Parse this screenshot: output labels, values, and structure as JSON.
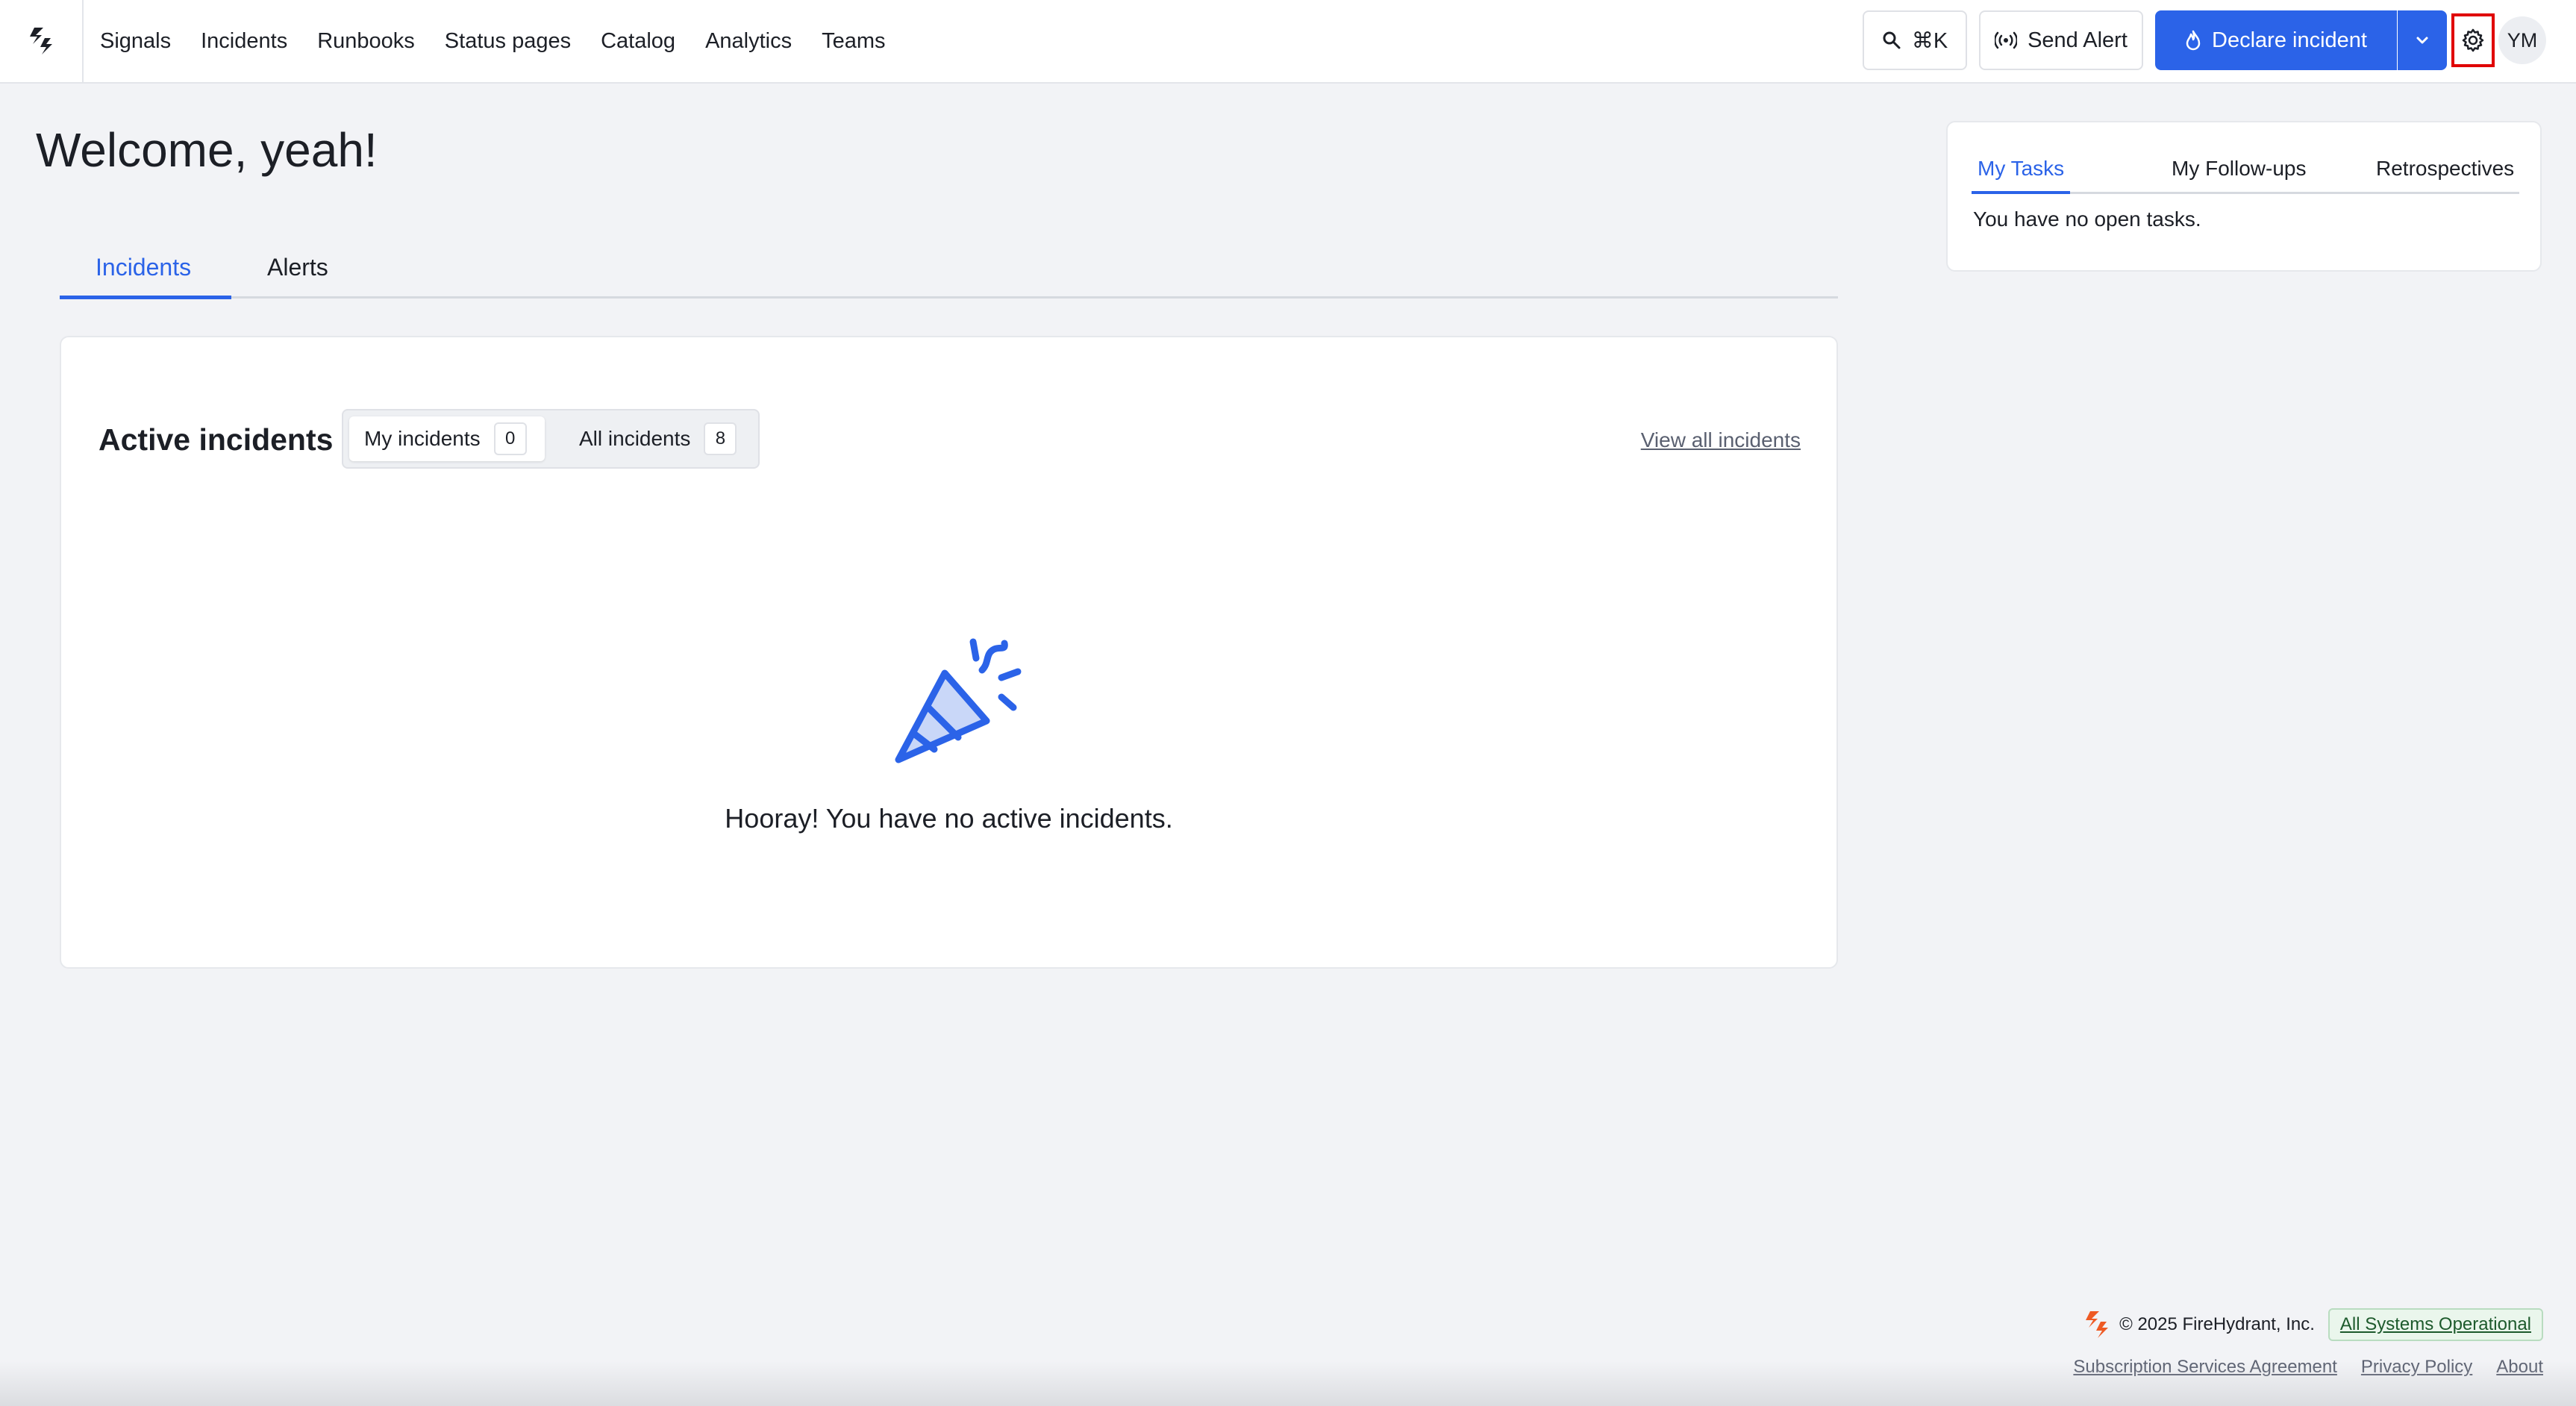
{
  "nav": {
    "links": [
      "Signals",
      "Incidents",
      "Runbooks",
      "Status pages",
      "Catalog",
      "Analytics",
      "Teams"
    ],
    "search_shortcut": "⌘K",
    "send_alert_label": "Send Alert",
    "declare_label": "Declare incident",
    "avatar_initials": "YM"
  },
  "page": {
    "welcome": "Welcome, yeah!",
    "tabs": [
      "Incidents",
      "Alerts"
    ],
    "active_tab": "Incidents"
  },
  "active_incidents": {
    "title": "Active incidents",
    "filters": [
      {
        "label": "My incidents",
        "count": "0"
      },
      {
        "label": "All incidents",
        "count": "8"
      }
    ],
    "view_all_label": "View all incidents",
    "empty_message": "Hooray! You have no active incidents."
  },
  "side_panel": {
    "tabs": [
      "My Tasks",
      "My Follow-ups",
      "Retrospectives"
    ],
    "active_tab": "My Tasks",
    "empty_message": "You have no open tasks."
  },
  "footer": {
    "copyright": "© 2025 FireHydrant, Inc.",
    "status": "All Systems Operational",
    "links": [
      "Subscription Services Agreement",
      "Privacy Policy",
      "About"
    ]
  },
  "colors": {
    "accent": "#2b63e8",
    "highlight_box": "#e00000",
    "brand_logo": "#ee5a24"
  },
  "icons": [
    "firehydrant-logo-icon",
    "search-icon",
    "broadcast-icon",
    "flame-icon",
    "chevron-down-icon",
    "gear-icon",
    "party-popper-icon"
  ]
}
